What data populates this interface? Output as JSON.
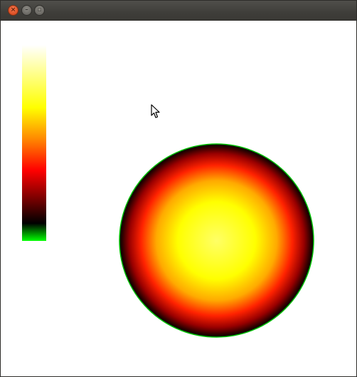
{
  "window": {
    "title": "",
    "buttons": {
      "close_icon": "close-icon",
      "minimize_icon": "minimize-icon",
      "maximize_icon": "maximize-icon",
      "close_glyph": "×",
      "minimize_glyph": "–",
      "maximize_glyph": "▫"
    }
  },
  "colors": {
    "close": "#e0552b",
    "title_bar": "#3f3e3a",
    "circle_outline": "#00c000"
  },
  "colormap": {
    "name_icon": "heat-colorbar",
    "stops": [
      "#00ff00",
      "#000000",
      "#550000",
      "#ff0000",
      "#ff8000",
      "#ffff00",
      "#ffff80",
      "#ffffff"
    ]
  },
  "heat_disk": {
    "center_color": "#ffff66",
    "edge_color": "#000000"
  },
  "cursor": {
    "icon": "mouse-pointer-icon"
  }
}
